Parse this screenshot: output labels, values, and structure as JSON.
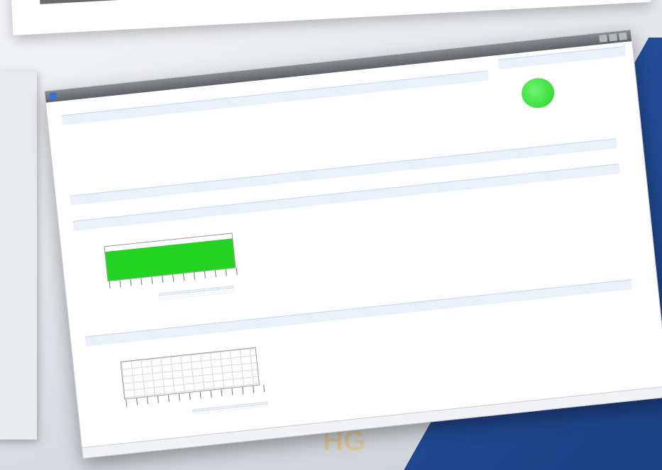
{
  "window": {
    "title": ""
  },
  "tab": {
    "label": ""
  },
  "status": {
    "color": "#22d322"
  },
  "sections": {
    "info": {
      "header": ""
    },
    "port": {
      "header": ""
    },
    "chart1": {
      "header": ""
    },
    "chart2": {
      "header": ""
    }
  },
  "info_rows": [
    {
      "label": "",
      "value": ""
    },
    {
      "label": "",
      "value": ""
    },
    {
      "label": "",
      "value": ""
    },
    {
      "label": "",
      "value": ""
    },
    {
      "label": "",
      "value": ""
    },
    {
      "label": "",
      "value": ""
    }
  ],
  "info_right_rows": [
    {
      "label": "",
      "value": ""
    },
    {
      "label": "",
      "value": ""
    },
    {
      "label": "",
      "value": ""
    }
  ],
  "chart1": {
    "title": "",
    "subtitle": "",
    "xlabel": "",
    "ylabel": ""
  },
  "chart2": {
    "title": "",
    "subtitle": "",
    "xlabel": "",
    "ylabel": ""
  },
  "table1": {
    "headers": [
      "",
      "",
      "",
      "",
      ""
    ],
    "rows": [
      [
        "",
        "",
        "",
        "",
        ""
      ],
      [
        "",
        "",
        "",
        "",
        ""
      ]
    ]
  },
  "table2": {
    "headers": [
      "",
      "",
      "",
      "",
      ""
    ],
    "rows": [
      [
        "",
        "",
        "",
        "",
        ""
      ]
    ]
  },
  "links": {
    "top_right": "",
    "mid_right": "",
    "lower_right": ""
  }
}
